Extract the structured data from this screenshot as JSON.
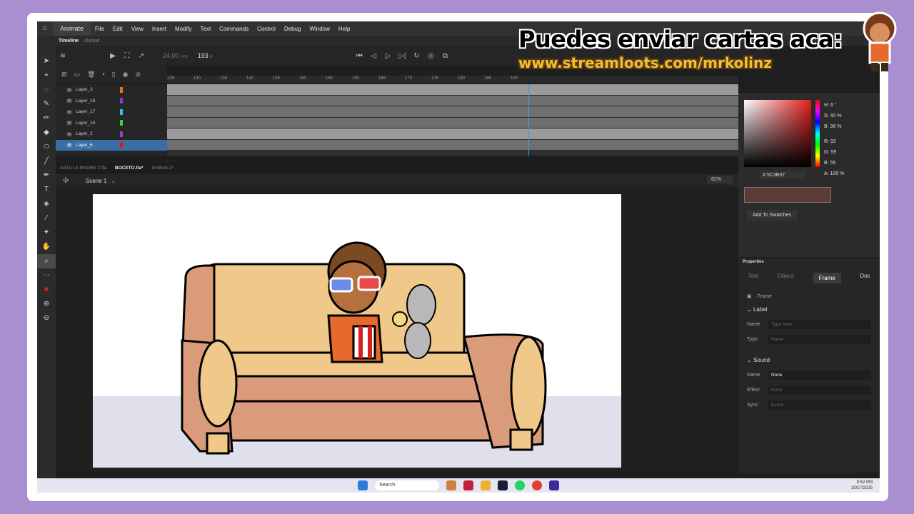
{
  "menu": {
    "workspace": "Animate",
    "items": [
      "File",
      "Edit",
      "View",
      "Insert",
      "Modify",
      "Text",
      "Commands",
      "Control",
      "Debug",
      "Window",
      "Help"
    ]
  },
  "timeline": {
    "tabs": [
      "Timeline",
      "Output"
    ],
    "fps": "24,00",
    "fps_unit": "FPS",
    "current_frame": "193",
    "frame_unit": "F",
    "ruler": [
      "125",
      "130",
      "135",
      "140",
      "145",
      "150",
      "155",
      "160",
      "165",
      "170",
      "175",
      "180",
      "185",
      "190"
    ],
    "layers": [
      {
        "name": "Layer_3",
        "color": "#e07c1a"
      },
      {
        "name": "Layer_18",
        "color": "#8a3fd0"
      },
      {
        "name": "Layer_17",
        "color": "#1ad0e0"
      },
      {
        "name": "Layer_15",
        "color": "#3fd03f"
      },
      {
        "name": "Layer_2",
        "color": "#9a3fd0"
      },
      {
        "name": "Layer_6",
        "color": "#e01a1a"
      }
    ],
    "selected_layer": "Layer_6"
  },
  "documents": {
    "tabs": [
      "ASTA LA MADRE 2.fla",
      "BOCETO.fla*",
      "Untitled-1*"
    ],
    "active": "BOCETO.fla*"
  },
  "scene": {
    "name": "Scene 1",
    "zoom": "62%"
  },
  "color": {
    "h": "H: 6 °",
    "s": "S: 40 %",
    "b": "B: 36 %",
    "r": "R: 92",
    "g": "G: 59",
    "bb": "B: 55",
    "a": "A: 100 %",
    "hex_label": "#",
    "hex": "5C3B37",
    "swatch_color": "#5c3b37",
    "add_swatch": "Add To Swatches"
  },
  "properties": {
    "title": "Properties",
    "tabs": [
      "Tool",
      "Object",
      "Frame",
      "Doc"
    ],
    "active_tab": "Frame",
    "frame_label": "Frame",
    "label_section": "Label",
    "name_label": "Name",
    "name_placeholder": "Type here",
    "type_label": "Type",
    "type_value": "Name",
    "sound_section": "Sound",
    "sound_name_label": "Name",
    "sound_name_value": "None",
    "effect_label": "Effect",
    "effect_value": "None",
    "sync_label": "Sync",
    "sync_value": "Event"
  },
  "taskbar": {
    "search": "Search",
    "time": "8:52 PM",
    "date": "10/17/2025"
  },
  "overlay": {
    "line1": "Puedes enviar cartas aca:",
    "line2": "www.streamloots.com/mrkolinz"
  }
}
